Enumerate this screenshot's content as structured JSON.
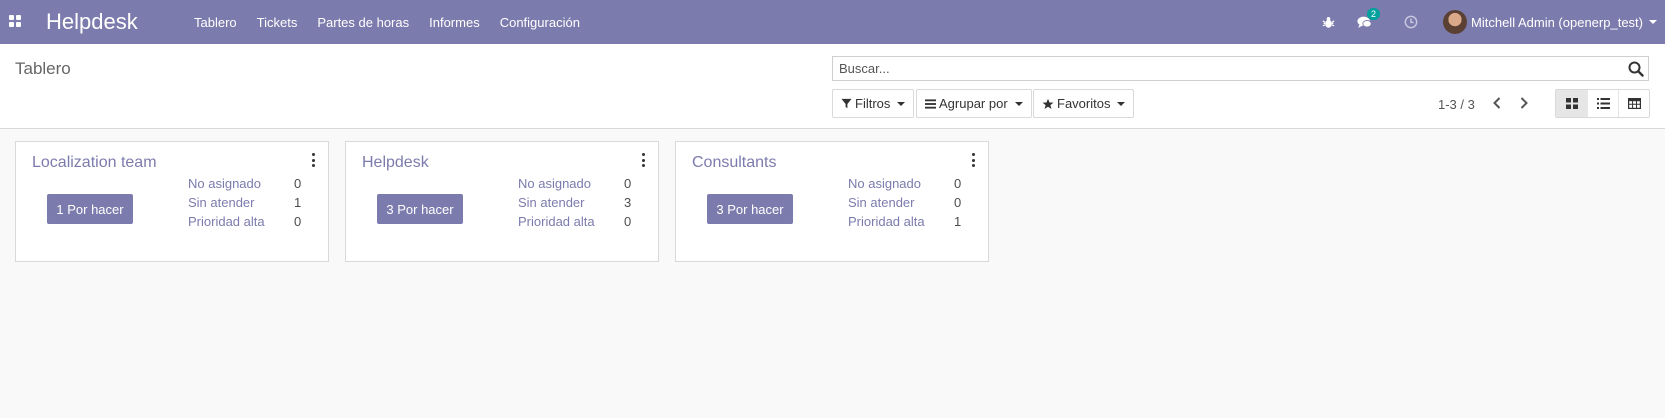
{
  "navbar": {
    "app_name": "Helpdesk",
    "menu": [
      {
        "label": "Tablero"
      },
      {
        "label": "Tickets"
      },
      {
        "label": "Partes de horas"
      },
      {
        "label": "Informes"
      },
      {
        "label": "Configuración"
      }
    ],
    "messages_count": "2",
    "user_name": "Mitchell Admin (openerp_test)",
    "color": "#7c7bad"
  },
  "control_panel": {
    "breadcrumb": "Tablero",
    "search_placeholder": "Buscar...",
    "filters_label": "Filtros",
    "groupby_label": "Agrupar por",
    "favorites_label": "Favoritos",
    "pager": "1-3 / 3"
  },
  "kanban": {
    "cards": [
      {
        "title": "Localization team",
        "todo_button": "1 Por hacer",
        "stats": [
          {
            "label": "No asignado",
            "value": "0"
          },
          {
            "label": "Sin atender",
            "value": "1"
          },
          {
            "label": "Prioridad alta",
            "value": "0"
          }
        ]
      },
      {
        "title": "Helpdesk",
        "todo_button": "3 Por hacer",
        "stats": [
          {
            "label": "No asignado",
            "value": "0"
          },
          {
            "label": "Sin atender",
            "value": "3"
          },
          {
            "label": "Prioridad alta",
            "value": "0"
          }
        ]
      },
      {
        "title": "Consultants",
        "todo_button": "3 Por hacer",
        "stats": [
          {
            "label": "No asignado",
            "value": "0"
          },
          {
            "label": "Sin atender",
            "value": "0"
          },
          {
            "label": "Prioridad alta",
            "value": "1"
          }
        ]
      }
    ]
  },
  "icons": [
    "apps-icon",
    "bug-icon",
    "chat-icon",
    "clock-icon",
    "search-icon",
    "filter-icon",
    "list-icon",
    "star-icon",
    "chevron-left-icon",
    "chevron-right-icon",
    "kanban-view-icon",
    "list-view-icon",
    "grid-view-icon",
    "kebab-menu-icon"
  ]
}
